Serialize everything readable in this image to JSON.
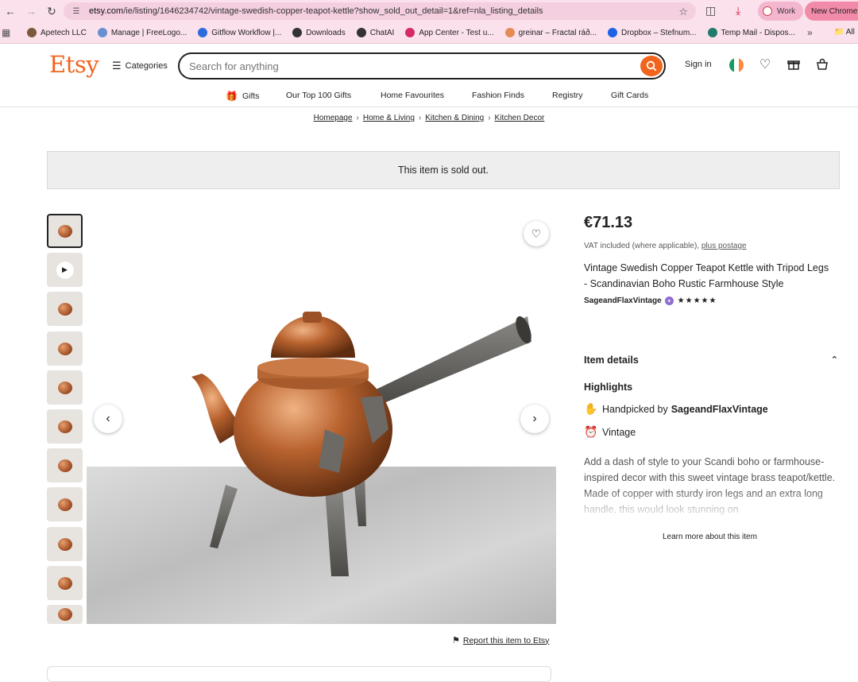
{
  "browser": {
    "url_host": "etsy.com",
    "url_path": "/ie/listing/1646234742/vintage-swedish-copper-teapot-kettle?show_sold_out_detail=1&ref=nla_listing_details",
    "profile_label": "Work",
    "new_chrome_label": "New Chrome a",
    "bookmarks": [
      {
        "label": "Apetech LLC",
        "color": "#7a5a3a"
      },
      {
        "label": "Manage | FreeLogo...",
        "color": "#6a8fd0"
      },
      {
        "label": "Gitflow Workflow |...",
        "color": "#2d6bdc"
      },
      {
        "label": "Downloads",
        "color": "#333333"
      },
      {
        "label": "ChatAI",
        "color": "#333333"
      },
      {
        "label": "App Center - Test u...",
        "color": "#d42a6a"
      },
      {
        "label": "greinar – Fractal ráð...",
        "color": "#e58b56"
      },
      {
        "label": "Dropbox – Stefnum...",
        "color": "#1c63e6"
      },
      {
        "label": "Temp Mail - Dispos...",
        "color": "#1f7b6b"
      }
    ],
    "all_bookmarks_label": "All"
  },
  "header": {
    "logo": "Etsy",
    "categories_label": "Categories",
    "search_placeholder": "Search for anything",
    "sign_in_label": "Sign in"
  },
  "subnav": [
    "Gifts",
    "Our Top 100 Gifts",
    "Home Favourites",
    "Fashion Finds",
    "Registry",
    "Gift Cards"
  ],
  "breadcrumb": [
    "Homepage",
    "Home & Living",
    "Kitchen & Dining",
    "Kitchen Decor"
  ],
  "sold_out_message": "This item is sold out.",
  "listing": {
    "price": "€71.13",
    "vat_text": "VAT included (where applicable),",
    "postage_link": "plus postage",
    "title": "Vintage Swedish Copper Teapot Kettle with Tripod Legs - Scandinavian Boho Rustic Farmhouse Style",
    "seller": "SageandFlaxVintage",
    "rating_stars": "★★★★★",
    "item_details_label": "Item details",
    "highlights_label": "Highlights",
    "handpicked_prefix": "Handpicked by",
    "handpicked_seller": "SageandFlaxVintage",
    "vintage_label": "Vintage",
    "description": "Add a dash of style to your Scandi boho or farmhouse-inspired decor with this sweet vintage brass teapot/kettle. Made of copper with sturdy iron legs and an extra long handle, this would look stunning on",
    "learn_more_label": "Learn more about this item",
    "report_label": "Report this item to Etsy"
  },
  "colors": {
    "etsy_orange": "#f1641e",
    "chrome_pink": "#fbe1ec"
  }
}
